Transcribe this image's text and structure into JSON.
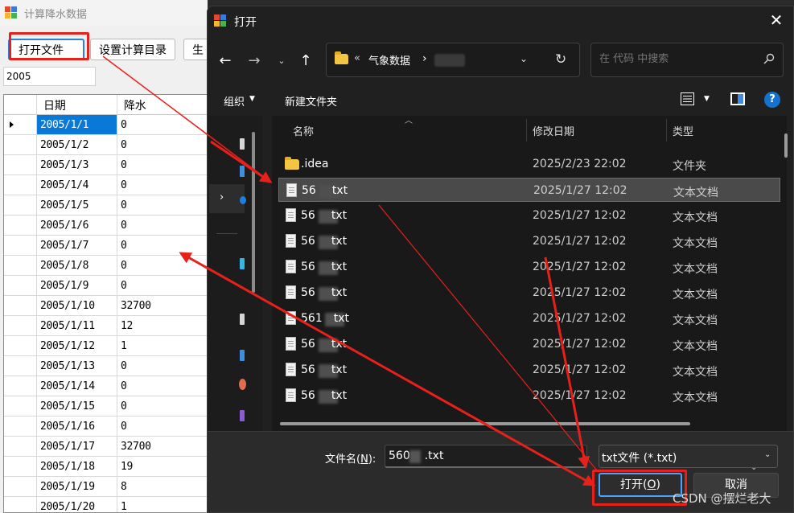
{
  "app": {
    "title": "计算降水数据",
    "buttons": {
      "open_file": "打开文件",
      "set_dir": "设置计算目录",
      "generate": "生"
    },
    "year_value": "2005",
    "grid": {
      "headers": [
        "日期",
        "降水"
      ],
      "rows": [
        [
          "2005/1/1",
          "0"
        ],
        [
          "2005/1/2",
          "0"
        ],
        [
          "2005/1/3",
          "0"
        ],
        [
          "2005/1/4",
          "0"
        ],
        [
          "2005/1/5",
          "0"
        ],
        [
          "2005/1/6",
          "0"
        ],
        [
          "2005/1/7",
          "0"
        ],
        [
          "2005/1/8",
          "0"
        ],
        [
          "2005/1/9",
          "0"
        ],
        [
          "2005/1/10",
          "32700"
        ],
        [
          "2005/1/11",
          "12"
        ],
        [
          "2005/1/12",
          "1"
        ],
        [
          "2005/1/13",
          "0"
        ],
        [
          "2005/1/14",
          "0"
        ],
        [
          "2005/1/15",
          "0"
        ],
        [
          "2005/1/16",
          "0"
        ],
        [
          "2005/1/17",
          "32700"
        ],
        [
          "2005/1/18",
          "19"
        ],
        [
          "2005/1/19",
          "8"
        ],
        [
          "2005/1/20",
          "1"
        ]
      ]
    }
  },
  "dialog": {
    "title": "打开",
    "close_glyph": "✕",
    "nav": {
      "back": "←",
      "forward": "→",
      "recent": "⌄",
      "up": "↑"
    },
    "address": {
      "overflow": "«",
      "crumb1": "气象数据",
      "separator": "›",
      "dropdown": "⌄",
      "refresh": "↻"
    },
    "search": {
      "placeholder": "在 代码 中搜索"
    },
    "toolbar": {
      "organize": "组织",
      "organize_caret": "▼",
      "new_folder": "新建文件夹",
      "view_caret": "▼",
      "help": "?"
    },
    "nav_pane": {
      "expand": "›"
    },
    "columns": {
      "name": "名称",
      "date": "修改日期",
      "type": "类型",
      "sort": "︿"
    },
    "files": [
      {
        "icon": "folder-icon",
        "name": ".idea",
        "date": "2025/2/23 22:02",
        "type": "文件夹",
        "selected": false
      },
      {
        "icon": "doc-icon",
        "name": "56",
        "suffix": "txt",
        "date": "2025/1/27 12:02",
        "type": "文本文档",
        "selected": true
      },
      {
        "icon": "doc-icon",
        "name": "56",
        "suffix": "txt",
        "date": "2025/1/27 12:02",
        "type": "文本文档",
        "selected": false
      },
      {
        "icon": "doc-icon",
        "name": "56",
        "suffix": "txt",
        "date": "2025/1/27 12:02",
        "type": "文本文档",
        "selected": false
      },
      {
        "icon": "doc-icon",
        "name": "56",
        "suffix": "txt",
        "date": "2025/1/27 12:02",
        "type": "文本文档",
        "selected": false
      },
      {
        "icon": "doc-icon",
        "name": "56",
        "suffix": "txt",
        "date": "2025/1/27 12:02",
        "type": "文本文档",
        "selected": false
      },
      {
        "icon": "doc-icon",
        "name": "561",
        "suffix": "txt",
        "date": "2025/1/27 12:02",
        "type": "文本文档",
        "selected": false
      },
      {
        "icon": "doc-icon",
        "name": "56",
        "suffix": "txt",
        "date": "2025/1/27 12:02",
        "type": "文本文档",
        "selected": false
      },
      {
        "icon": "doc-icon",
        "name": "56",
        "suffix": "txt",
        "date": "2025/1/27 12:02",
        "type": "文本文档",
        "selected": false
      },
      {
        "icon": "doc-icon",
        "name": "56",
        "suffix": "txt",
        "date": "2025/1/27 12:02",
        "type": "文本文档",
        "selected": false
      }
    ],
    "footer": {
      "filename_label": "文件名(N):",
      "filename_value": "560",
      "filename_suffix": ".txt",
      "filename_dropdown": "⌄",
      "filetype": "txt文件 (*.txt)",
      "filetype_caret": "⌄",
      "open_button": "打开(O)",
      "cancel_button": "取消"
    }
  },
  "watermark": "CSDN @摆烂老大",
  "colors": {
    "annotation": "#e8201a",
    "selection": "#0a78d7",
    "dialog_bg": "#202020"
  }
}
